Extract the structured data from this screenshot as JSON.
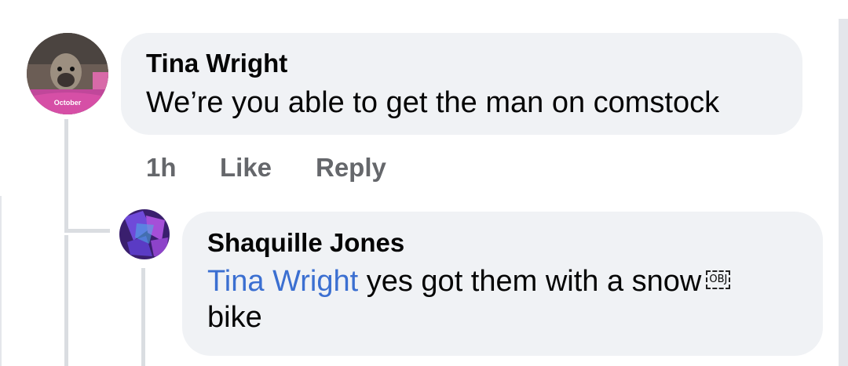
{
  "comment": {
    "author": "Tina Wright",
    "text": "We’re you able to get the man on comstock",
    "time": "1h",
    "like_label": "Like",
    "reply_label": "Reply",
    "avatar_caption": "October"
  },
  "reply": {
    "author": "Shaquille Jones",
    "mention": "Tina Wright",
    "text_line1": " yes got them with a snow",
    "object_placeholder": "OBJ",
    "text_line2": "bike"
  },
  "colors": {
    "bubble": "#f0f2f5",
    "mention": "#3b6fd1",
    "meta": "#65676b"
  }
}
